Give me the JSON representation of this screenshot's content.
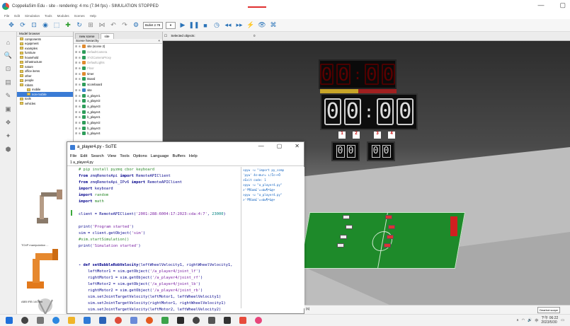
{
  "window": {
    "title": "CoppeliaSim Edu - site - rendering: 4 ms (7.94 fps) - SIMULATION STOPPED",
    "minimize": "—",
    "maximize": "▢"
  },
  "menu": [
    "File",
    "Edit",
    "Simulation",
    "Tools",
    "Modules",
    "Scenes",
    "Help"
  ],
  "toolbar": {
    "dt_combo": "Bullet 2.78",
    "icons": [
      "pan-icon",
      "rotate-icon",
      "fit-icon",
      "camera-icon",
      "select-icon",
      "move-icon",
      "rotate-object-icon",
      "assemble-icon",
      "undo-icon",
      "redo-icon",
      "engine-icon",
      "play-icon",
      "pause-icon",
      "stop-icon",
      "realtime-icon",
      "slow-icon",
      "fast-icon",
      "thread-icon",
      "visual-icon"
    ]
  },
  "model_browser": {
    "title": "Model browser",
    "items": [
      {
        "label": "components",
        "sel": false,
        "ind": false
      },
      {
        "label": "equipment",
        "sel": false,
        "ind": false
      },
      {
        "label": "examples",
        "sel": false,
        "ind": false
      },
      {
        "label": "furniture",
        "sel": false,
        "ind": false
      },
      {
        "label": "household",
        "sel": false,
        "ind": false
      },
      {
        "label": "infrastructure",
        "sel": false,
        "ind": false
      },
      {
        "label": "nature",
        "sel": false,
        "ind": false
      },
      {
        "label": "office items",
        "sel": false,
        "ind": false
      },
      {
        "label": "other",
        "sel": false,
        "ind": false
      },
      {
        "label": "people",
        "sel": false,
        "ind": false
      },
      {
        "label": "robots",
        "sel": false,
        "ind": false
      },
      {
        "label": "mobile",
        "sel": false,
        "ind": true
      },
      {
        "label": "non-mobile",
        "sel": true,
        "ind": true
      },
      {
        "label": "tools",
        "sel": false,
        "ind": false
      },
      {
        "label": "vehicles",
        "sel": false,
        "ind": false
      }
    ],
    "thumb1": "TO4P manipulation ...",
    "thumb2": "ABB IRB 140.ttm"
  },
  "scene": {
    "tabs": [
      "new scene",
      "site"
    ],
    "header": "Scene hierarchy",
    "rows": [
      {
        "label": "site (scene 2)",
        "grey": false
      },
      {
        "label": "DefaultCamera",
        "grey": true
      },
      {
        "label": "XYZCameraProxy",
        "grey": true
      },
      {
        "label": "DefaultLights",
        "grey": true
      },
      {
        "label": "Floor",
        "grey": true
      },
      {
        "label": "timer",
        "grey": false
      },
      {
        "label": "Board",
        "grey": false
      },
      {
        "label": "scoreboard",
        "grey": false
      },
      {
        "label": "site",
        "grey": false
      },
      {
        "label": "a_player1",
        "grey": false
      },
      {
        "label": "a_player2",
        "grey": false
      },
      {
        "label": "a_player3",
        "grey": false
      },
      {
        "label": "a_player4",
        "grey": false
      },
      {
        "label": "b_player1",
        "grey": false
      },
      {
        "label": "b_player2",
        "grey": false
      },
      {
        "label": "b_player3",
        "grey": false
      },
      {
        "label": "b_player4",
        "grey": false
      }
    ]
  },
  "selection_bar": {
    "label": "Selected objects:",
    "count": "0"
  },
  "scoreboard": {
    "top": [
      "0",
      "0",
      "0",
      "0"
    ],
    "timer": [
      "0",
      "0",
      "0",
      "0"
    ],
    "score_left": [
      "0",
      "0"
    ],
    "score_right": [
      "0",
      "0"
    ],
    "flags": [
      "1",
      "2",
      "3",
      "4"
    ]
  },
  "scite": {
    "title": "a_player4.py - SciTE",
    "menu": [
      "File",
      "Edit",
      "Search",
      "View",
      "Tools",
      "Options",
      "Language",
      "Buffers",
      "Help"
    ],
    "tab": "1 a_player4.py",
    "close": "✕"
  },
  "code": [
    {
      "parts": [
        {
          "c": "cm",
          "t": "# pip install pyzmq cbor keyboard"
        }
      ]
    },
    {
      "parts": [
        {
          "c": "kw",
          "t": "from "
        },
        {
          "c": "plain",
          "t": "zmqRemoteApi "
        },
        {
          "c": "kw",
          "t": "import "
        },
        {
          "c": "plain",
          "t": "RemoteAPIClient"
        }
      ]
    },
    {
      "parts": [
        {
          "c": "kw",
          "t": "from "
        },
        {
          "c": "plain",
          "t": "zmqRemoteApi_IPv6 "
        },
        {
          "c": "kw",
          "t": "import "
        },
        {
          "c": "plain",
          "t": "RemoteAPIClient"
        }
      ]
    },
    {
      "parts": [
        {
          "c": "kw",
          "t": "import "
        },
        {
          "c": "plain",
          "t": "keyboard"
        }
      ]
    },
    {
      "parts": [
        {
          "c": "kw",
          "t": "import "
        },
        {
          "c": "cm",
          "t": "random"
        }
      ]
    },
    {
      "parts": [
        {
          "c": "kw",
          "t": "import "
        },
        {
          "c": "cm",
          "t": "math"
        }
      ]
    },
    {
      "parts": [
        {
          "c": "plain",
          "t": ""
        }
      ]
    },
    {
      "parts": [
        {
          "c": "plain",
          "t": "client = RemoteAPIClient("
        },
        {
          "c": "str",
          "t": "'2001:288:6004:17:2023:cda:4:7'"
        },
        {
          "c": "plain",
          "t": ", "
        },
        {
          "c": "num",
          "t": "23000"
        },
        {
          "c": "plain",
          "t": ")"
        }
      ]
    },
    {
      "parts": [
        {
          "c": "plain",
          "t": ""
        }
      ]
    },
    {
      "parts": [
        {
          "c": "plain",
          "t": "print("
        },
        {
          "c": "str",
          "t": "'Program started'"
        },
        {
          "c": "plain",
          "t": ")"
        }
      ]
    },
    {
      "parts": [
        {
          "c": "plain",
          "t": "sim = client.getObject("
        },
        {
          "c": "str",
          "t": "'sim'"
        },
        {
          "c": "plain",
          "t": ")"
        }
      ]
    },
    {
      "parts": [
        {
          "c": "cm",
          "t": "#sim.startSimulation()"
        }
      ]
    },
    {
      "parts": [
        {
          "c": "plain",
          "t": "print("
        },
        {
          "c": "str",
          "t": "'Simulation started'"
        },
        {
          "c": "plain",
          "t": ")"
        }
      ]
    },
    {
      "parts": [
        {
          "c": "plain",
          "t": ""
        }
      ]
    },
    {
      "parts": [
        {
          "c": "plain",
          "t": ""
        }
      ]
    },
    {
      "parts": [
        {
          "c": "kw",
          "t": "- def "
        },
        {
          "c": "kw",
          "t": "setBubbleRobVelocity"
        },
        {
          "c": "plain",
          "t": "(leftWheelVelocity1, rightWheelVelocity1,"
        }
      ]
    },
    {
      "parts": [
        {
          "c": "plain",
          "t": "    leftMotor1 = sim.getObject("
        },
        {
          "c": "str",
          "t": "'/a_player4/joint_lf'"
        },
        {
          "c": "plain",
          "t": ")"
        }
      ]
    },
    {
      "parts": [
        {
          "c": "plain",
          "t": "    rightMotor1 = sim.getObject("
        },
        {
          "c": "str",
          "t": "'/a_player4/joint_rf'"
        },
        {
          "c": "plain",
          "t": ")"
        }
      ]
    },
    {
      "parts": [
        {
          "c": "plain",
          "t": "    leftMotor2 = sim.getObject("
        },
        {
          "c": "str",
          "t": "'/a_player4/joint_lb'"
        },
        {
          "c": "plain",
          "t": ")"
        }
      ]
    },
    {
      "parts": [
        {
          "c": "plain",
          "t": "    rightMotor2 = sim.getObject("
        },
        {
          "c": "str",
          "t": "'/a_player4/joint_rb'"
        },
        {
          "c": "plain",
          "t": ")"
        }
      ]
    },
    {
      "parts": [
        {
          "c": "plain",
          "t": "    sim.setJointTargetVelocity(leftMotor1, leftWheelVelocity1)"
        }
      ]
    },
    {
      "parts": [
        {
          "c": "plain",
          "t": "    sim.setJointTargetVelocity(rightMotor1, rightWheelVelocity1)"
        }
      ]
    },
    {
      "parts": [
        {
          "c": "plain",
          "t": "    sim.setJointTargetVelocity(leftMotor2, leftWheelVelocity2)"
        }
      ]
    },
    {
      "parts": [
        {
          "c": "plain",
          "t": "    sim.setJointTargetVelocity(rightMotor2, rightWheelVelocity2)"
        }
      ]
    }
  ],
  "output": [
    ">pyw -u \"import py_comp",
    "'pyw' 4ε¬Ωur= ı/Îε¬+Ö",
    ">Exit code: 1",
    ">pyw -u \"a_player4.py\"",
    ">'f¶ßam£'=¤Ωw¶ª&@+",
    ">pyw -u \"a_player4.py\"",
    ">'f¶ßam£'=¤Ωw¶ª&@+"
  ],
  "status": {
    "text": "(s)",
    "combo": "Dearbot.scape"
  },
  "taskbar": {
    "time": "下午 06:22",
    "date": "2023/5/30",
    "lang": "中"
  },
  "colors": {
    "field": "#1e8a2a",
    "accent": "#3a7bd5",
    "goal": "#d02020"
  }
}
